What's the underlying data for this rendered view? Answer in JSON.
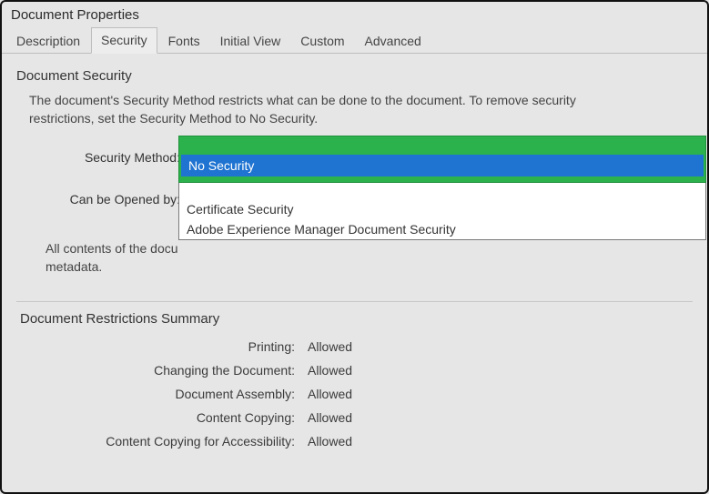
{
  "window": {
    "title": "Document Properties"
  },
  "tabs": {
    "items": [
      {
        "label": "Description"
      },
      {
        "label": "Security"
      },
      {
        "label": "Fonts"
      },
      {
        "label": "Initial View"
      },
      {
        "label": "Custom"
      },
      {
        "label": "Advanced"
      }
    ],
    "active_index": 1
  },
  "security": {
    "section_title": "Document Security",
    "help_text": "The document's Security Method restricts what can be done to the document. To remove security restrictions, set the Security Method to No Security.",
    "method_label": "Security Method:",
    "opened_by_label": "Can be Opened by:",
    "dropdown": {
      "selected": "No Security",
      "options": [
        "Certificate Security",
        "Adobe Experience Manager Document Security"
      ]
    },
    "contents_text_prefix": "All contents of the docu",
    "contents_text_suffix": "metadata."
  },
  "restrictions": {
    "title": "Document Restrictions Summary",
    "rows": [
      {
        "label": "Printing:",
        "value": "Allowed"
      },
      {
        "label": "Changing the Document:",
        "value": "Allowed"
      },
      {
        "label": "Document Assembly:",
        "value": "Allowed"
      },
      {
        "label": "Content Copying:",
        "value": "Allowed"
      },
      {
        "label": "Content Copying for Accessibility:",
        "value": "Allowed"
      }
    ]
  }
}
